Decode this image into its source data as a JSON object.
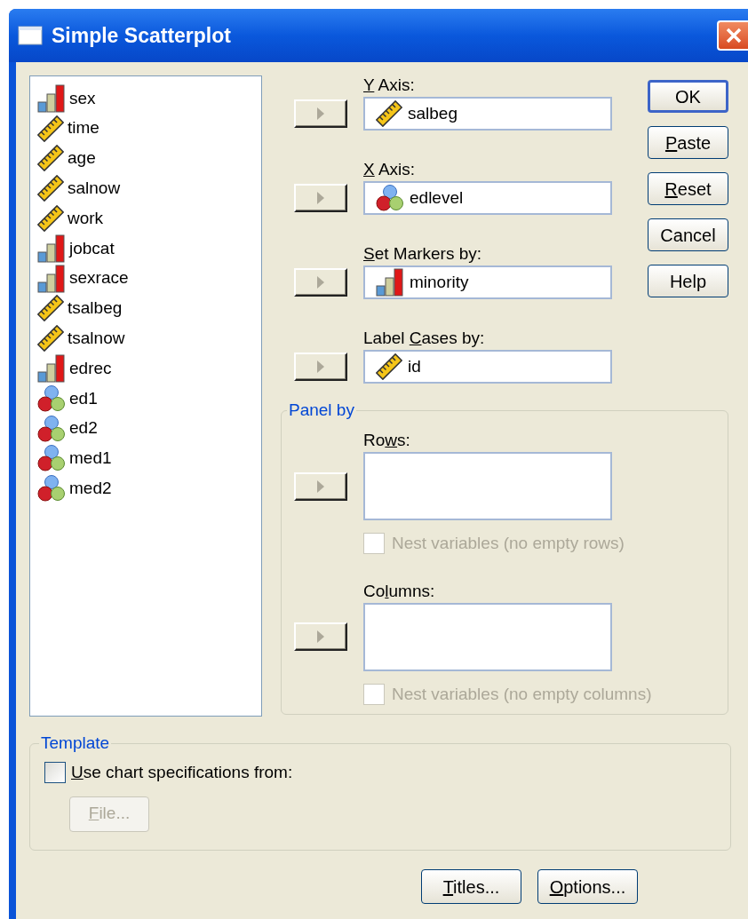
{
  "window": {
    "title": "Simple Scatterplot"
  },
  "variables": [
    {
      "name": "sex",
      "kind": "ordinal"
    },
    {
      "name": "time",
      "kind": "scale"
    },
    {
      "name": "age",
      "kind": "scale"
    },
    {
      "name": "salnow",
      "kind": "scale"
    },
    {
      "name": "work",
      "kind": "scale"
    },
    {
      "name": "jobcat",
      "kind": "ordinal"
    },
    {
      "name": "sexrace",
      "kind": "ordinal"
    },
    {
      "name": "tsalbeg",
      "kind": "scale"
    },
    {
      "name": "tsalnow",
      "kind": "scale"
    },
    {
      "name": "edrec",
      "kind": "ordinal"
    },
    {
      "name": "ed1",
      "kind": "nominal"
    },
    {
      "name": "ed2",
      "kind": "nominal"
    },
    {
      "name": "med1",
      "kind": "nominal"
    },
    {
      "name": "med2",
      "kind": "nominal"
    }
  ],
  "targets": [
    {
      "label": {
        "key": "Y",
        "post": " Axis:"
      },
      "value": "salbeg",
      "kind": "scale"
    },
    {
      "label": {
        "key": "X",
        "post": " Axis:"
      },
      "value": "edlevel",
      "kind": "nominal"
    },
    {
      "label": {
        "key": "S",
        "post": "et Markers by:"
      },
      "value": "minority",
      "kind": "ordinal"
    },
    {
      "label": {
        "pre": "Label ",
        "key": "C",
        "post": "ases by:"
      },
      "value": "id",
      "kind": "scale"
    }
  ],
  "buttons": [
    {
      "label": {
        "post": "OK"
      },
      "default": true
    },
    {
      "label": {
        "key": "P",
        "post": "aste"
      },
      "default": false
    },
    {
      "label": {
        "key": "R",
        "post": "eset"
      },
      "default": false
    },
    {
      "label": {
        "post": "Cancel"
      },
      "default": false
    },
    {
      "label": {
        "post": "Help"
      },
      "default": false
    }
  ],
  "panel_by": {
    "title": "Panel by",
    "groups": [
      {
        "label": {
          "pre": "Ro",
          "key": "w",
          "post": "s:"
        },
        "nest": {
          "label": "Nest variables (no empty rows)",
          "checked": false,
          "disabled": true
        }
      },
      {
        "label": {
          "pre": "Co",
          "key": "l",
          "post": "umns:"
        },
        "nest": {
          "label": "Nest variables (no empty columns)",
          "checked": false,
          "disabled": true
        }
      }
    ]
  },
  "template": {
    "title": "Template",
    "use": {
      "label": {
        "key": "U",
        "post": "se chart specifications from:"
      },
      "checked": false
    },
    "file_button": {
      "label": {
        "key": "F",
        "post": "ile..."
      },
      "disabled": true
    }
  },
  "bottom_buttons": [
    {
      "label": {
        "key": "T",
        "post": "itles..."
      }
    },
    {
      "label": {
        "key": "O",
        "post": "ptions..."
      }
    }
  ]
}
